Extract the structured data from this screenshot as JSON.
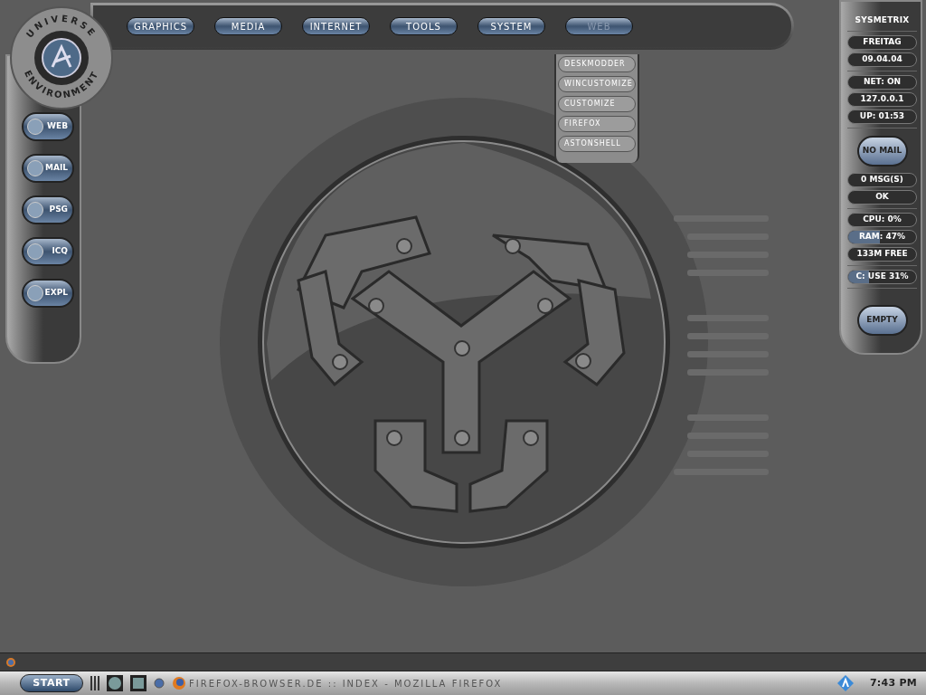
{
  "logo": {
    "ring_top": "UNIVERSE",
    "ring_bottom": "ENVIRONMENT"
  },
  "top_menu": [
    {
      "label": "GRAPHICS",
      "selected": false
    },
    {
      "label": "MEDIA",
      "selected": false
    },
    {
      "label": "INTERNET",
      "selected": false
    },
    {
      "label": "TOOLS",
      "selected": false
    },
    {
      "label": "SYSTEM",
      "selected": false
    },
    {
      "label": "WEB",
      "selected": true
    }
  ],
  "dropdown": [
    "DESKMODDER",
    "WINCUSTOMIZE",
    "CUSTOMIZE",
    "FIREFOX",
    "ASTONSHELL"
  ],
  "launcher": [
    "WEB",
    "MAIL",
    "PSG",
    "ICQ",
    "EXPL"
  ],
  "sysmetrix": {
    "title": "SYSMETRIX",
    "groups": [
      [
        {
          "kind": "text",
          "text": "FREITAG"
        },
        {
          "kind": "text",
          "text": "09.04.04"
        }
      ],
      [
        {
          "kind": "text",
          "text": "NET: ON"
        },
        {
          "kind": "text",
          "text": "127.0.0.1"
        },
        {
          "kind": "text",
          "text": "UP: 01:53"
        }
      ],
      [
        {
          "kind": "mail",
          "text": "NO MAIL"
        },
        {
          "kind": "text",
          "text": "0 MSG(S)"
        },
        {
          "kind": "text",
          "text": "OK"
        }
      ],
      [
        {
          "kind": "text",
          "text": "CPU: 0%"
        },
        {
          "kind": "meter",
          "text": "RAM: 47%",
          "level": 0.47
        },
        {
          "kind": "text",
          "text": "133M FREE"
        }
      ],
      [
        {
          "kind": "meter",
          "text": "C: USE 31%",
          "level": 0.31
        }
      ],
      [
        {
          "kind": "trash",
          "text": "EMPTY"
        }
      ]
    ]
  },
  "taskbar": {
    "start": "START",
    "task": "FIREFOX-BROWSER.DE :: INDEX - MOZILLA FIREFOX",
    "clock": "7:43 PM"
  }
}
